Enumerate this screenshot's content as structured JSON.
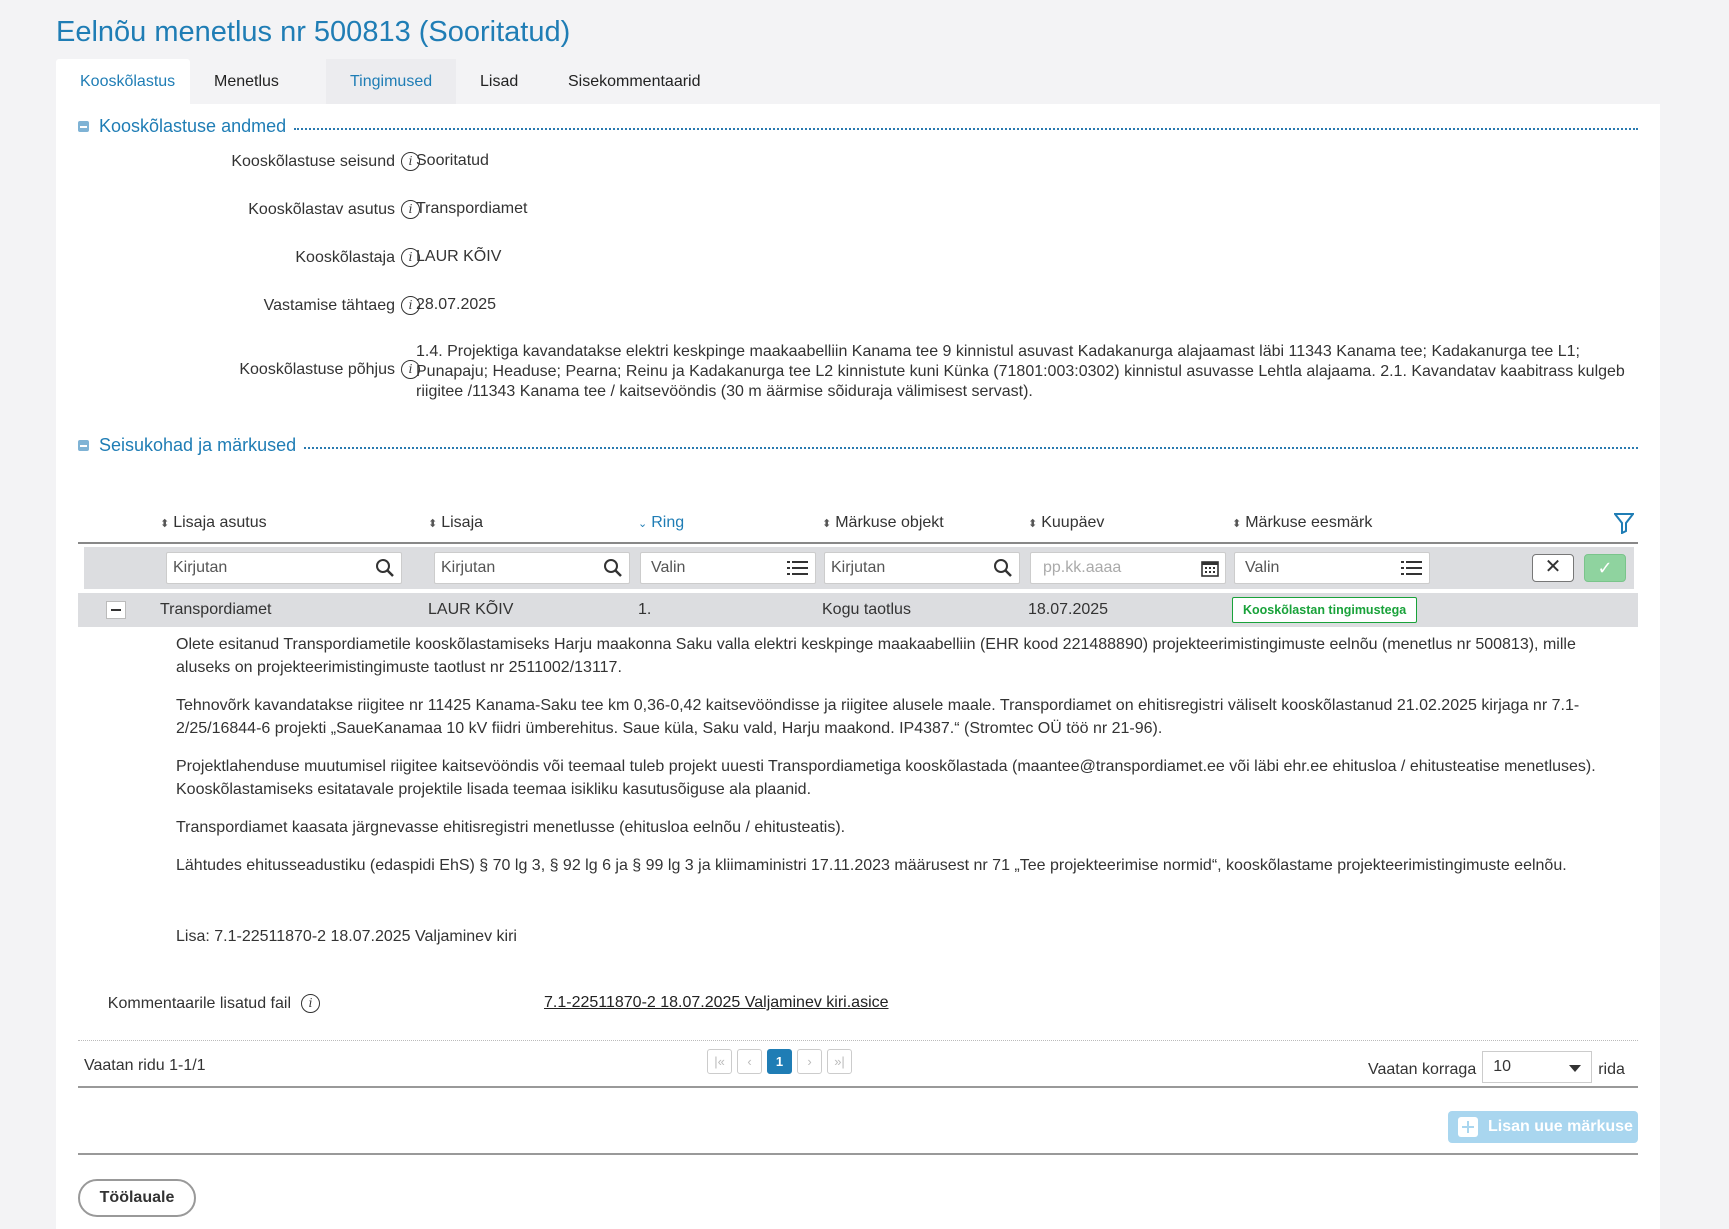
{
  "page": {
    "title": "Eelnõu menetlus nr 500813 (Sooritatud)"
  },
  "tabs": [
    {
      "label": "Kooskõlastus"
    },
    {
      "label": "Menetlus"
    },
    {
      "label": "Tingimused"
    },
    {
      "label": "Lisad"
    },
    {
      "label": "Sisekommentaarid"
    }
  ],
  "section1": {
    "title": "Kooskõlastuse andmed",
    "fields": [
      {
        "label": "Kooskõlastuse seisund",
        "value": "Sooritatud"
      },
      {
        "label": "Kooskõlastav asutus",
        "value": "Transpordiamet"
      },
      {
        "label": "Kooskõlastaja",
        "value": "LAUR KÕIV"
      },
      {
        "label": "Vastamise tähtaeg",
        "value": "28.07.2025"
      },
      {
        "label": "Kooskõlastuse põhjus",
        "value": "1.4. Projektiga kavandatakse elektri keskpinge maakaabelliin Kanama tee 9 kinnistul asuvast Kadakanurga alajaamast läbi 11343 Kanama tee; Kadakanurga tee L1; Punapaju; Headuse; Pearna; Reinu ja Kadakanurga tee L2 kinnistute kuni Künka (71801:003:0302) kinnistul asuvasse Lehtla alajaama. 2.1. Kavandatav kaabitrass kulgeb riigitee /11343 Kanama tee / kaitsevööndis (30 m äärmise sõiduraja välimisest servast)."
      }
    ]
  },
  "section2": {
    "title": "Seisukohad ja märkused",
    "columns": [
      "Lisaja asutus",
      "Lisaja",
      "Ring",
      "Märkuse objekt",
      "Kuupäev",
      "Märkuse eesmärk"
    ],
    "filters": {
      "lisaja_asutus": "Kirjutan",
      "lisaja": "Kirjutan",
      "ring": "Valin",
      "objekt": "Kirjutan",
      "kuupaev": "pp.kk.aaaa",
      "eesmark": "Valin"
    },
    "row": {
      "lisaja_asutus": "Transpordiamet",
      "lisaja": "LAUR KÕIV",
      "ring": "1.",
      "objekt": "Kogu taotlus",
      "kuupaev": "18.07.2025",
      "eesmark": "Kooskõlastan tingimustega"
    },
    "comment": [
      "Olete esitanud Transpordiametile kooskõlastamiseks Harju maakonna Saku valla elektri keskpinge maakaabelliin (EHR kood 221488890) projekteerimistingimuste eelnõu (menetlus nr 500813), mille aluseks on projekteerimistingimuste taotlust nr 2511002/13117.",
      "Tehnovõrk kavandatakse riigitee nr 11425 Kanama-Saku tee km 0,36-0,42 kaitsevööndisse ja riigitee alusele maale. Transpordiamet on ehitisregistri väliselt kooskõlastanud 21.02.2025 kirjaga nr 7.1-2/25/16844-6 projekti „SaueKanamaa 10 kV fiidri ümberehitus. Saue küla, Saku vald, Harju maakond. IP4387.“ (Stromtec OÜ töö nr 21-96).",
      "Projektlahenduse muutumisel riigitee kaitsevööndis või teemaal tuleb projekt uuesti Transpordiametiga kooskõlastada (maantee@transpordiamet.ee või läbi ehr.ee ehitusloa / ehitusteatise menetluses). Kooskõlastamiseks esitatavale projektile lisada teemaa isikliku kasutusõiguse ala plaanid.",
      "Transpordiamet kaasata järgnevasse ehitisregistri menetlusse (ehitusloa eelnõu / ehitusteatis).",
      "Lähtudes ehitusseadustiku (edaspidi EhS) § 70 lg 3, § 92 lg 6 ja § 99 lg 3 ja kliimaministri 17.11.2023 määrusest nr 71 „Tee projekteerimise normid“, kooskõlastame projekteerimistingimuste eelnõu.",
      "Lisa: 7.1-22511870-2 18.07.2025 Valjaminev kiri"
    ],
    "attachment": {
      "label": "Kommentaarile lisatud fail",
      "file": "7.1-22511870-2 18.07.2025 Valjaminev kiri.asice"
    },
    "pager": {
      "info": "Vaatan ridu 1-1/1",
      "first": "|«",
      "prev": "‹",
      "current": "1",
      "next": "›",
      "last": "»|",
      "per_page_label": "Vaatan korraga",
      "per_page_value": "10",
      "per_page_suffix": "rida"
    },
    "add_button": "Lisan uue märkuse"
  },
  "footer": {
    "back_button": "Töölauale"
  },
  "colors": {
    "accent": "#1f7db5",
    "badge_green": "#19a23a"
  }
}
